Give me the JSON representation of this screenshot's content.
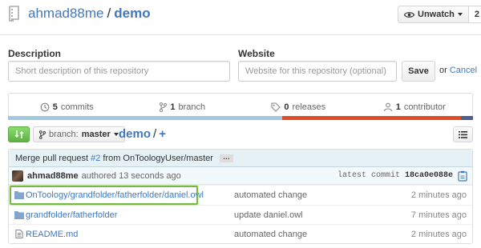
{
  "repo": {
    "owner": "ahmad88me",
    "separator": "/",
    "name": "demo"
  },
  "watch": {
    "label": "Unwatch",
    "count": "2"
  },
  "about": {
    "description_label": "Description",
    "description_placeholder": "Short description of this repository",
    "website_label": "Website",
    "website_placeholder": "Website for this repository (optional)",
    "save_label": "Save",
    "or_text": "or",
    "cancel_label": "Cancel"
  },
  "summary": {
    "commits": {
      "count": "5",
      "label": "commits"
    },
    "branches": {
      "count": "1",
      "label": "branch"
    },
    "releases": {
      "count": "0",
      "label": "releases"
    },
    "contributors": {
      "count": "1",
      "label": "contributor"
    }
  },
  "language_bar": [
    {
      "color": "#a1cae0",
      "share": 0.59
    },
    {
      "color": "#e44b23",
      "share": 0.385
    },
    {
      "color": "#4f5d95",
      "share": 0.025
    }
  ],
  "nav": {
    "branch_prefix": "branch:",
    "branch_name": "master",
    "breadcrumb_root": "demo",
    "breadcrumb_sep": "/",
    "breadcrumb_plus": "+"
  },
  "commit": {
    "message_prefix": "Merge pull request",
    "pr_number": "#2",
    "message_suffix": "from OnToologyUser/master",
    "ellipsis": "…",
    "author": "ahmad88me",
    "authored_text": "authored 13 seconds ago",
    "latest_label": "latest commit",
    "sha": "18ca0e088e"
  },
  "files": [
    {
      "icon": "folder-icon",
      "name": "OnToology/grandfolder/fatherfolder/daniel.owl",
      "message": "automated change",
      "age": "2 minutes ago"
    },
    {
      "icon": "folder-icon",
      "name": "grandfolder/fatherfolder",
      "message": "update daniel.owl",
      "age": "7 minutes ago"
    },
    {
      "icon": "file-text-icon",
      "name": "README.md",
      "message": "automated change",
      "age": "2 minutes ago"
    }
  ],
  "colors": {
    "link": "#4078c0",
    "highlight": "#72bb3e",
    "compare_button": "#60b044"
  }
}
